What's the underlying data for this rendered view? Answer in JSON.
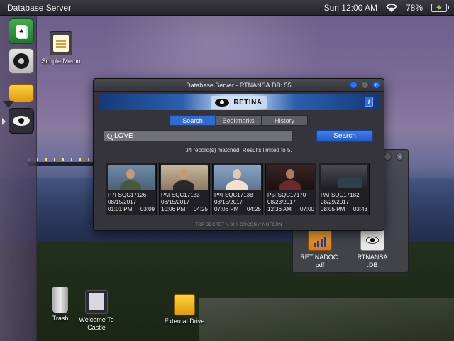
{
  "topbar": {
    "title": "Database Server",
    "time": "Sun 12:00 AM",
    "battery": "78%"
  },
  "dock": {
    "solitaire_glyph": "♠",
    "items": [
      "solitaire-icon",
      "settings-gear-icon",
      "external-drive-icon",
      "retina-eye-icon"
    ]
  },
  "desktop": {
    "simple_memo": "Simple Memo",
    "trash": "Trash",
    "welcome": "Welcome To Castle",
    "external_drive": "External Drive"
  },
  "file_window": {
    "files": [
      {
        "name": "RETINADOC.\npdf"
      },
      {
        "name": "RTNANSA\n.DB"
      }
    ],
    "file1_line1": "RETINADOC.",
    "file1_line2": "pdf",
    "file2_line1": "RTNANSA",
    "file2_line2": ".DB"
  },
  "window": {
    "title": "Database Server - RTNANSA.DB: 55",
    "logo_text": "RETINA",
    "info_label": "i",
    "minimize_label": "–",
    "close_label": "×",
    "tabs": [
      {
        "label": "Search",
        "active": true
      },
      {
        "label": "Bookmarks",
        "active": false
      },
      {
        "label": "History",
        "active": false
      }
    ],
    "search_value": "LOVE",
    "search_button": "Search",
    "status": "34 record(s) matched. Results limited to 5.",
    "results": [
      {
        "id": "P7FSQC17126",
        "date": "08/15/2017",
        "time": "01:01 PM",
        "duration": "03:09"
      },
      {
        "id": "PAFSQC17133",
        "date": "08/15/2017",
        "time": "10:06 PM",
        "duration": "04:25"
      },
      {
        "id": "PAFSQC17138",
        "date": "08/15/2017",
        "time": "07:06 PM",
        "duration": "04:25"
      },
      {
        "id": "P5FSQC17170",
        "date": "08/23/2017",
        "time": "12:36 AM",
        "duration": "07:00"
      },
      {
        "id": "PAFSQC17182",
        "date": "08/29/2017",
        "time": "08:05 PM",
        "duration": "03:43"
      }
    ],
    "footer": "TOP SECRET // SI // ORCON // NOFORN"
  },
  "colors": {
    "accent": "#2f6bd6",
    "window_bg": "#34343a"
  }
}
